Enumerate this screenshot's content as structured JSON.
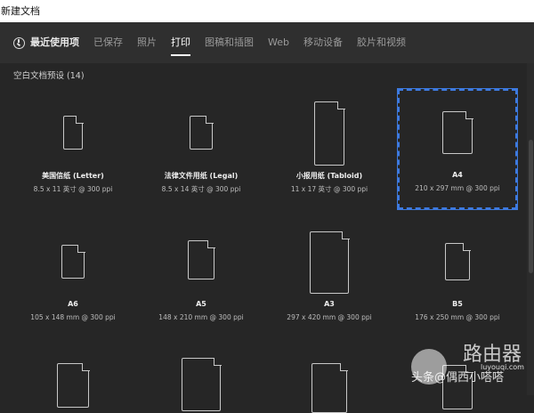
{
  "window": {
    "title": "新建文档"
  },
  "tabs": [
    {
      "label": "最近使用项"
    },
    {
      "label": "已保存"
    },
    {
      "label": "照片"
    },
    {
      "label": "打印"
    },
    {
      "label": "图稿和插图"
    },
    {
      "label": "Web"
    },
    {
      "label": "移动设备"
    },
    {
      "label": "胶片和视频"
    }
  ],
  "section": {
    "title": "空白文档预设 (14)"
  },
  "presets": [
    {
      "name": "美国信纸 (Letter)",
      "spec": "8.5 x 11 英寸 @ 300 ppi"
    },
    {
      "name": "法律文件用纸 (Legal)",
      "spec": "8.5 x 14 英寸 @ 300 ppi"
    },
    {
      "name": "小报用纸 (Tabloid)",
      "spec": "11 x 17 英寸 @ 300 ppi"
    },
    {
      "name": "A4",
      "spec": "210 x 297 mm @ 300 ppi"
    },
    {
      "name": "A6",
      "spec": "105 x 148 mm @ 300 ppi"
    },
    {
      "name": "A5",
      "spec": "148 x 210 mm @ 300 ppi"
    },
    {
      "name": "A3",
      "spec": "297 x 420 mm @ 300 ppi"
    },
    {
      "name": "B5",
      "spec": "176 x 250 mm @ 300 ppi"
    }
  ],
  "watermark": {
    "brand": "路由器",
    "site": "luyouqi.com",
    "author": "头条@偶西小嗒嗒"
  },
  "colors": {
    "selection": "#3d7ae0"
  }
}
